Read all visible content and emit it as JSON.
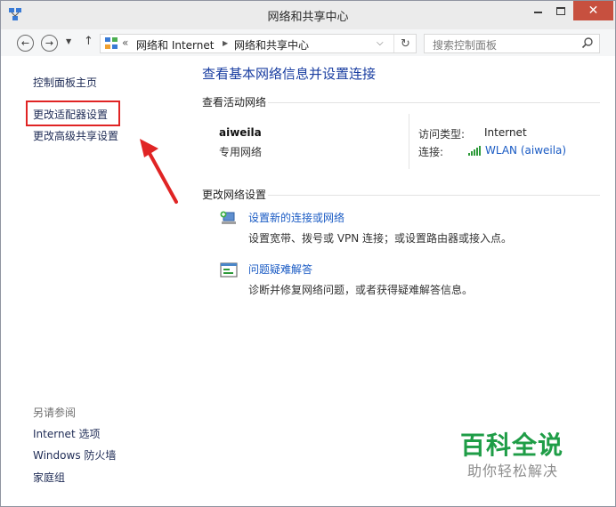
{
  "window": {
    "title": "网络和共享中心"
  },
  "address_bar": {
    "chevron": "«",
    "segments": [
      "网络和 Internet",
      "网络和共享中心"
    ]
  },
  "search": {
    "placeholder": "搜索控制面板"
  },
  "sidebar": {
    "home": "控制面板主页",
    "adapter_settings": "更改适配器设置",
    "advanced_sharing": "更改高级共享设置",
    "see_also_label": "另请参阅",
    "see_also_items": [
      "Internet 选项",
      "Windows 防火墙",
      "家庭组"
    ]
  },
  "main": {
    "title": "查看基本网络信息并设置连接",
    "active_networks_header": "查看活动网络",
    "network": {
      "name": "aiweila",
      "category": "专用网络",
      "access_type_label": "访问类型:",
      "access_type_value": "Internet",
      "connection_label": "连接:",
      "connection_value": "WLAN (aiweila)"
    },
    "change_settings_header": "更改网络设置",
    "tasks": [
      {
        "title": "设置新的连接或网络",
        "description": "设置宽带、拨号或 VPN 连接；或设置路由器或接入点。",
        "icon": "network-setup-icon"
      },
      {
        "title": "问题疑难解答",
        "description": "诊断并修复网络问题，或者获得疑难解答信息。",
        "icon": "troubleshoot-icon"
      }
    ]
  },
  "watermark": {
    "title": "百科全说",
    "subtitle": "助你轻松解决"
  },
  "colors": {
    "link_blue": "#1a5bc4",
    "title_blue": "#1a3ea1",
    "highlight_red": "#e02424",
    "close_button": "#c7503f",
    "watermark_green": "#1f9d47"
  }
}
